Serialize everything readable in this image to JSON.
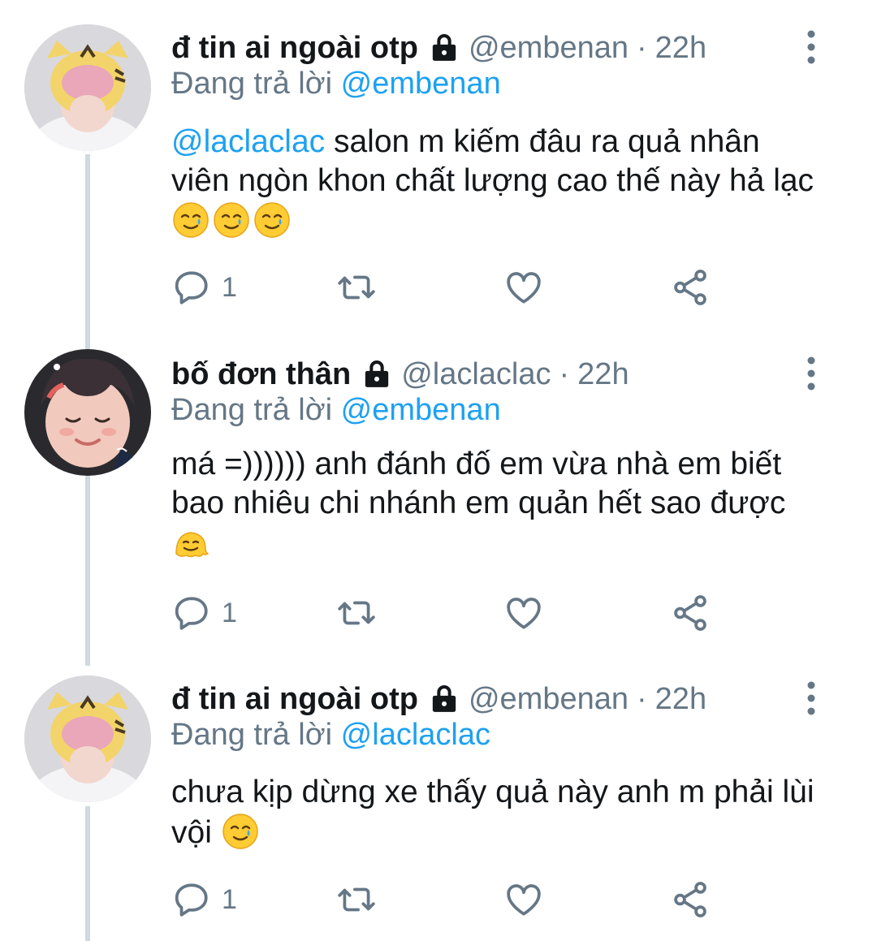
{
  "tweets": [
    {
      "display_name": "đ tin ai ngoài otp",
      "handle": "@embenan",
      "separator": "·",
      "time": "22h",
      "replying_prefix": "Đang trả lời",
      "replying_to": "@embenan",
      "body_mention": "@laclaclac",
      "body_text": " salon m kiếm đâu ra quả nhân viên ngòn khon chất lượng cao thế này hả lạc",
      "emojis": [
        "smiling-face-with-tear",
        "smiling-face-with-tear",
        "smiling-face-with-tear"
      ],
      "reply_count": "1"
    },
    {
      "display_name": "bố đơn thân",
      "handle": "@laclaclac",
      "separator": "·",
      "time": "22h",
      "replying_prefix": "Đang trả lời",
      "replying_to": "@embenan",
      "body_mention": "",
      "body_text": "má =)))))) anh đánh đố em vừa nhà em biết bao nhiêu chi nhánh em quản hết sao được",
      "emojis": [
        "melting-face"
      ],
      "reply_count": "1"
    },
    {
      "display_name": "đ tin ai ngoài otp",
      "handle": "@embenan",
      "separator": "·",
      "time": "22h",
      "replying_prefix": "Đang trả lời",
      "replying_to": "@laclaclac",
      "body_mention": "",
      "body_text": "chưa kịp dừng xe thấy quả này anh m phải lùi vội",
      "emojis": [
        "smiling-face-with-tear"
      ],
      "reply_count": "1"
    }
  ],
  "colors": {
    "text": "#14171a",
    "muted": "#657786",
    "link": "#1da1f2",
    "thread_line": "#cfd9de"
  },
  "icons": {
    "protected": "lock-icon",
    "more": "more-vertical-icon",
    "reply": "reply-icon",
    "retweet": "retweet-icon",
    "like": "heart-icon",
    "share": "share-icon"
  }
}
